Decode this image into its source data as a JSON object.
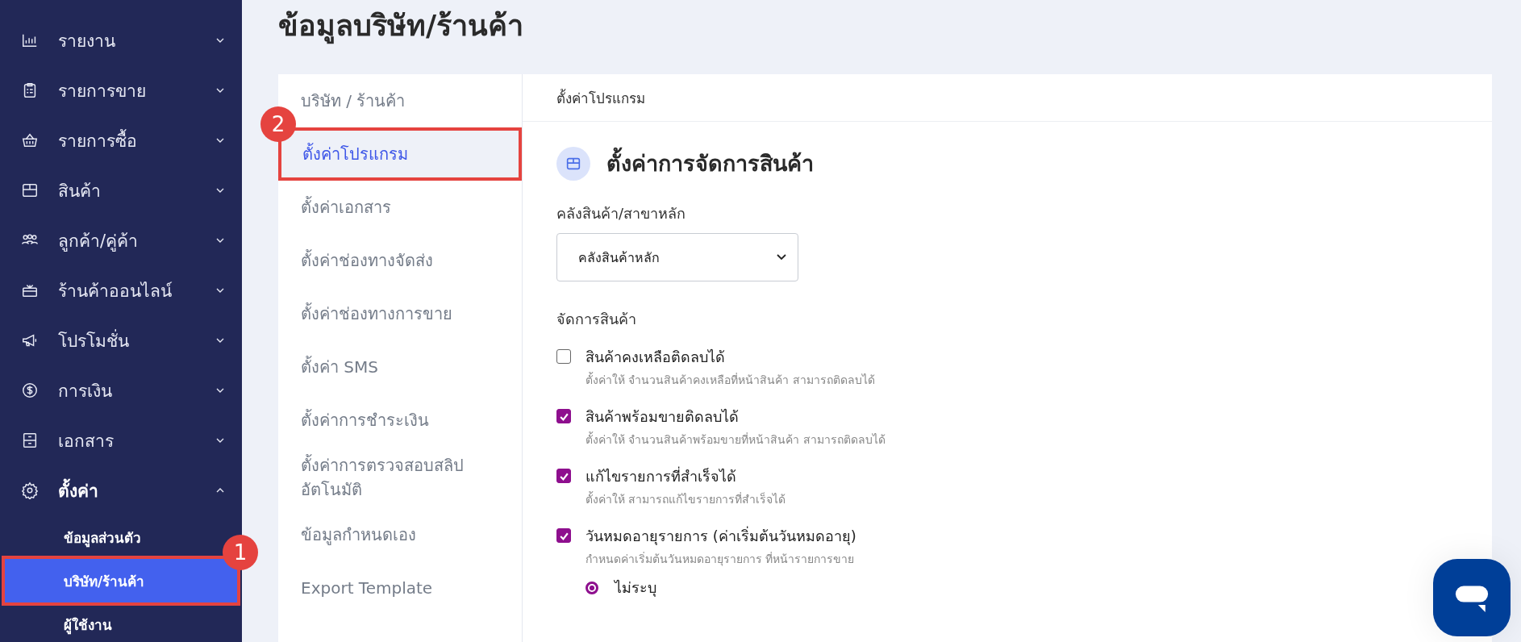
{
  "sidebar": {
    "items": [
      {
        "label": "รายงาน",
        "expanded": false
      },
      {
        "label": "รายการขาย",
        "expanded": false
      },
      {
        "label": "รายการซื้อ",
        "expanded": false
      },
      {
        "label": "สินค้า",
        "expanded": false
      },
      {
        "label": "ลูกค้า/คู่ค้า",
        "expanded": false
      },
      {
        "label": "ร้านค้าออนไลน์",
        "expanded": false
      },
      {
        "label": "โปรโมชั่น",
        "expanded": false
      },
      {
        "label": "การเงิน",
        "expanded": false
      },
      {
        "label": "เอกสาร",
        "expanded": false
      },
      {
        "label": "ตั้งค่า",
        "expanded": true,
        "children": [
          {
            "label": "ข้อมูลส่วนตัว",
            "selected": false
          },
          {
            "label": "บริษัท/ร้านค้า",
            "selected": true,
            "annotation": "1"
          },
          {
            "label": "ผู้ใช้งาน",
            "selected": false
          }
        ]
      }
    ]
  },
  "page_title": "ข้อมูลบริษัท/ร้านค้า",
  "settings_nav": [
    {
      "label": "บริษัท / ร้านค้า",
      "selected": false
    },
    {
      "label": "ตั้งค่าโปรแกรม",
      "selected": true,
      "annotation": "2"
    },
    {
      "label": "ตั้งค่าเอกสาร",
      "selected": false
    },
    {
      "label": "ตั้งค่าช่องทางจัดส่ง",
      "selected": false
    },
    {
      "label": "ตั้งค่าช่องทางการขาย",
      "selected": false
    },
    {
      "label": "ตั้งค่า SMS",
      "selected": false
    },
    {
      "label": "ตั้งค่าการชำระเงิน",
      "selected": false
    },
    {
      "label": "ตั้งค่าการตรวจสอบสลิปอัตโนมัติ",
      "selected": false
    },
    {
      "label": "ข้อมูลกำหนดเอง",
      "selected": false
    },
    {
      "label": "Export Template",
      "selected": false
    }
  ],
  "panel": {
    "header": "ตั้งค่าโปรแกรม",
    "section_title": "ตั้งค่าการจัดการสินค้า",
    "warehouse": {
      "label": "คลังสินค้า/สาขาหลัก",
      "value": "คลังสินค้าหลัก"
    },
    "group_label": "จัดการสินค้า",
    "options": [
      {
        "label": "สินค้าคงเหลือติดลบได้",
        "description": "ตั้งค่าให้ จำนวนสินค้าคงเหลือที่หน้าสินค้า สามารถติดลบได้",
        "checked": false
      },
      {
        "label": "สินค้าพร้อมขายติดลบได้",
        "description": "ตั้งค่าให้ จำนวนสินค้าพร้อมขายที่หน้าสินค้า สามารถติดลบได้",
        "checked": true
      },
      {
        "label": "แก้ไขรายการที่สำเร็จได้",
        "description": "ตั้งค่าให้ สามารถแก้ไขรายการที่สำเร็จได้",
        "checked": true
      },
      {
        "label": "วันหมดอายุรายการ (ค่าเริ่มต้นวันหมดอายุ)",
        "description": "กำหนดค่าเริ่มต้นวันหมดอายุรายการ ที่หน้ารายการขาย",
        "checked": true,
        "choices": [
          {
            "label": "ไม่ระบุ",
            "selected": true
          }
        ]
      }
    ]
  }
}
